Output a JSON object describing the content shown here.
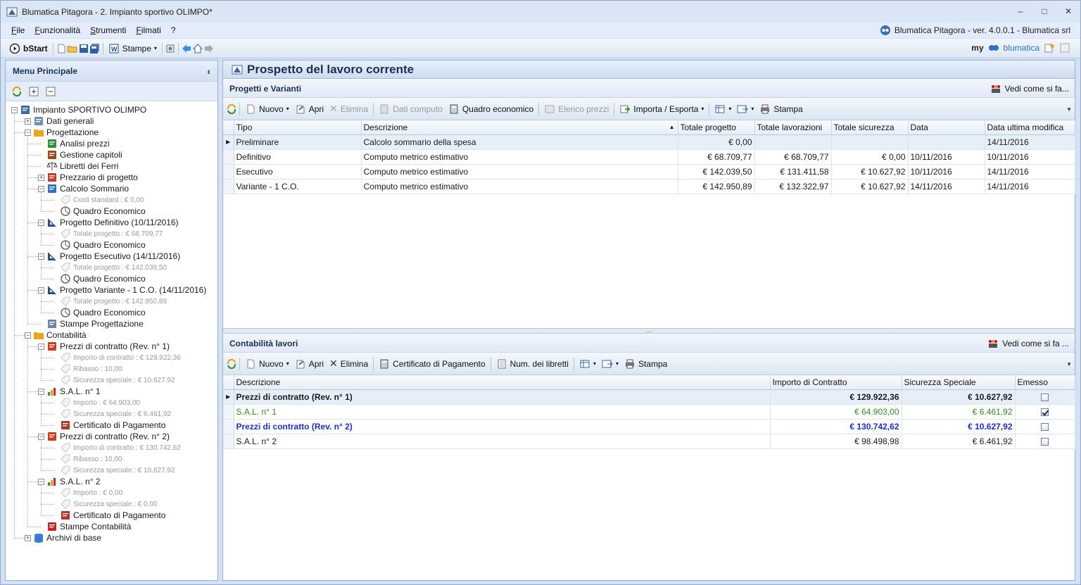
{
  "window": {
    "title": "Blumatica Pitagora - 2. Impianto sportivo OLIMPO*",
    "version": "Blumatica Pitagora - ver. 4.0.0.1 - Blumatica srl"
  },
  "menu": {
    "items": [
      {
        "key": "F",
        "rest": "ile"
      },
      {
        "key": "F",
        "rest": "unzionalità"
      },
      {
        "key": "S",
        "rest": "trumenti"
      },
      {
        "key": "F",
        "rest": "ilmati"
      },
      {
        "key": "",
        "rest": "?"
      }
    ]
  },
  "toolbar": {
    "bstart": "bStart",
    "stampe": "Stampe",
    "brand_my": "my",
    "brand_name": "blumatica"
  },
  "sidebar": {
    "title": "Menu Principale",
    "tree": [
      {
        "label": "Impianto SPORTIVO OLIMPO",
        "level": 0,
        "icon": "project-icon",
        "exp": "-"
      },
      {
        "label": "Dati generali",
        "level": 1,
        "icon": "doc-icon",
        "exp": "+"
      },
      {
        "label": "Progettazione",
        "level": 1,
        "icon": "folder-project-icon",
        "exp": "-"
      },
      {
        "label": "Analisi prezzi",
        "level": 2,
        "icon": "grid-icon",
        "exp": ""
      },
      {
        "label": "Gestione capitoli",
        "level": 2,
        "icon": "chapter-icon",
        "exp": ""
      },
      {
        "label": "Libretti dei Ferri",
        "level": 2,
        "icon": "scale-icon",
        "exp": ""
      },
      {
        "label": "Prezzario di progetto",
        "level": 2,
        "icon": "price-list-icon",
        "exp": "+"
      },
      {
        "label": "Calcolo Sommario",
        "level": 2,
        "icon": "pencil-doc-icon",
        "exp": "-"
      },
      {
        "label": "Costi standard : € 0,00",
        "level": 3,
        "icon": "tag-icon",
        "exp": "",
        "dim": true
      },
      {
        "label": "Quadro Economico",
        "level": 3,
        "icon": "pie-icon",
        "exp": ""
      },
      {
        "label": "Progetto Definitivo (10/11/2016)",
        "level": 2,
        "icon": "triangle-ruler-icon",
        "exp": "-"
      },
      {
        "label": "Totale progetto : € 68.709,77",
        "level": 3,
        "icon": "tag-icon",
        "exp": "",
        "dim": true
      },
      {
        "label": "Quadro Economico",
        "level": 3,
        "icon": "pie-icon",
        "exp": ""
      },
      {
        "label": "Progetto Esecutivo (14/11/2016)",
        "level": 2,
        "icon": "triangle-ruler-icon",
        "exp": "-"
      },
      {
        "label": "Totale progetto : € 142.039,50",
        "level": 3,
        "icon": "tag-icon",
        "exp": "",
        "dim": true
      },
      {
        "label": "Quadro Economico",
        "level": 3,
        "icon": "pie-icon",
        "exp": ""
      },
      {
        "label": "Progetto Variante - 1 C.O. (14/11/2016)",
        "level": 2,
        "icon": "triangle-ruler-icon",
        "exp": "-"
      },
      {
        "label": "Totale progetto : € 142.950,89",
        "level": 3,
        "icon": "tag-icon",
        "exp": "",
        "dim": true
      },
      {
        "label": "Quadro Economico",
        "level": 3,
        "icon": "pie-icon",
        "exp": ""
      },
      {
        "label": "Stampe Progettazione",
        "level": 2,
        "icon": "printer-icon",
        "exp": ""
      },
      {
        "label": "Contabilità",
        "level": 1,
        "icon": "folder-euro-icon",
        "exp": "-"
      },
      {
        "label": "Prezzi di contratto (Rev. n° 1)",
        "level": 2,
        "icon": "euro-doc-icon",
        "exp": "-"
      },
      {
        "label": "Importo di contratto  : € 129.922,36",
        "level": 3,
        "icon": "tag-icon",
        "exp": "",
        "dim": true
      },
      {
        "label": "Ribasso  : 10,00",
        "level": 3,
        "icon": "tag-icon",
        "exp": "",
        "dim": true
      },
      {
        "label": "Sicurezza speciale  : € 10.627,92",
        "level": 3,
        "icon": "tag-icon",
        "exp": "",
        "dim": true
      },
      {
        "label": "S.A.L. n° 1",
        "level": 2,
        "icon": "bar-chart-icon",
        "exp": "-"
      },
      {
        "label": "Importo : € 64.903,00",
        "level": 3,
        "icon": "tag-icon",
        "exp": "",
        "dim": true
      },
      {
        "label": "Sicurezza speciale  : € 6.461,92",
        "level": 3,
        "icon": "tag-icon",
        "exp": "",
        "dim": true
      },
      {
        "label": "Certificato di Pagamento",
        "level": 3,
        "icon": "certificate-icon",
        "exp": ""
      },
      {
        "label": "Prezzi di contratto (Rev. n° 2)",
        "level": 2,
        "icon": "euro-doc-icon",
        "exp": "-"
      },
      {
        "label": "Importo di contratto  : € 130.742,62",
        "level": 3,
        "icon": "tag-icon",
        "exp": "",
        "dim": true
      },
      {
        "label": "Ribasso  : 10,00",
        "level": 3,
        "icon": "tag-icon",
        "exp": "",
        "dim": true
      },
      {
        "label": "Sicurezza speciale  : € 10.627,92",
        "level": 3,
        "icon": "tag-icon",
        "exp": "",
        "dim": true
      },
      {
        "label": "S.A.L. n° 2",
        "level": 2,
        "icon": "bar-chart-icon",
        "exp": "-"
      },
      {
        "label": "Importo : € 0,00",
        "level": 3,
        "icon": "tag-icon",
        "exp": "",
        "dim": true
      },
      {
        "label": "Sicurezza speciale  : € 0,00",
        "level": 3,
        "icon": "tag-icon",
        "exp": "",
        "dim": true
      },
      {
        "label": "Certificato di Pagamento",
        "level": 3,
        "icon": "certificate-icon",
        "exp": ""
      },
      {
        "label": "Stampe Contabilità",
        "level": 2,
        "icon": "printer-red-icon",
        "exp": ""
      },
      {
        "label": "Archivi di base",
        "level": 1,
        "icon": "database-icon",
        "exp": "+"
      }
    ]
  },
  "main": {
    "title": "Prospetto del lavoro corrente",
    "vedi": "Vedi come si fa...",
    "vedi2": "Vedi come si fa ...",
    "progetti": {
      "title": "Progetti e Varianti",
      "tools": {
        "nuovo": "Nuovo",
        "apri": "Apri",
        "elimina": "Elimina",
        "dati_computo": "Dati computo",
        "quadro": "Quadro economico",
        "elenco": "Elenco prezzi",
        "importa": "Importa / Esporta",
        "stampa": "Stampa"
      },
      "columns": [
        "Tipo",
        "Descrizione",
        "Totale progetto",
        "Totale lavorazioni",
        "Totale sicurezza",
        "Data",
        "Data ultima modifica"
      ],
      "rows": [
        [
          "Preliminare",
          "Calcolo sommario della spesa",
          "€ 0,00",
          "",
          "",
          "",
          "14/11/2016"
        ],
        [
          "Definitivo",
          "Computo metrico estimativo",
          "€ 68.709,77",
          "€ 68.709,77",
          "€ 0,00",
          "10/11/2016",
          "10/11/2016"
        ],
        [
          "Esecutivo",
          "Computo metrico estimativo",
          "€ 142.039,50",
          "€ 131.411,58",
          "€ 10.627,92",
          "10/11/2016",
          "14/11/2016"
        ],
        [
          "Variante - 1 C.O.",
          "Computo metrico estimativo",
          "€ 142.950,89",
          "€ 132.322,97",
          "€ 10.627,92",
          "14/11/2016",
          "14/11/2016"
        ]
      ]
    },
    "contabilita": {
      "title": "Contabilità lavori",
      "tools": {
        "nuovo": "Nuovo",
        "apri": "Apri",
        "elimina": "Elimina",
        "certificato": "Certificato di Pagamento",
        "num_libretti": "Num. dei libretti",
        "stampa": "Stampa"
      },
      "columns": [
        "Descrizione",
        "Importo di Contratto",
        "Sicurezza Speciale",
        "Emesso"
      ],
      "rows": [
        {
          "desc": "Prezzi di contratto (Rev. n° 1)",
          "importo": "€ 129.922,36",
          "sicurezza": "€ 10.627,92",
          "emesso": false,
          "style": "bold"
        },
        {
          "desc": "S.A.L. n° 1",
          "importo": "€ 64.903,00",
          "sicurezza": "€ 6.461,92",
          "emesso": true,
          "style": "green"
        },
        {
          "desc": "Prezzi di contratto (Rev. n° 2)",
          "importo": "€ 130.742,62",
          "sicurezza": "€ 10.627,92",
          "emesso": false,
          "style": "blue"
        },
        {
          "desc": "S.A.L. n° 2",
          "importo": "€ 98.498,98",
          "sicurezza": "€ 6.461,92",
          "emesso": false,
          "style": "normal"
        }
      ]
    }
  },
  "colors": {
    "accent": "#1b2f52",
    "green_row": "#2e8f1e",
    "blue_row": "#1a2fd0"
  }
}
